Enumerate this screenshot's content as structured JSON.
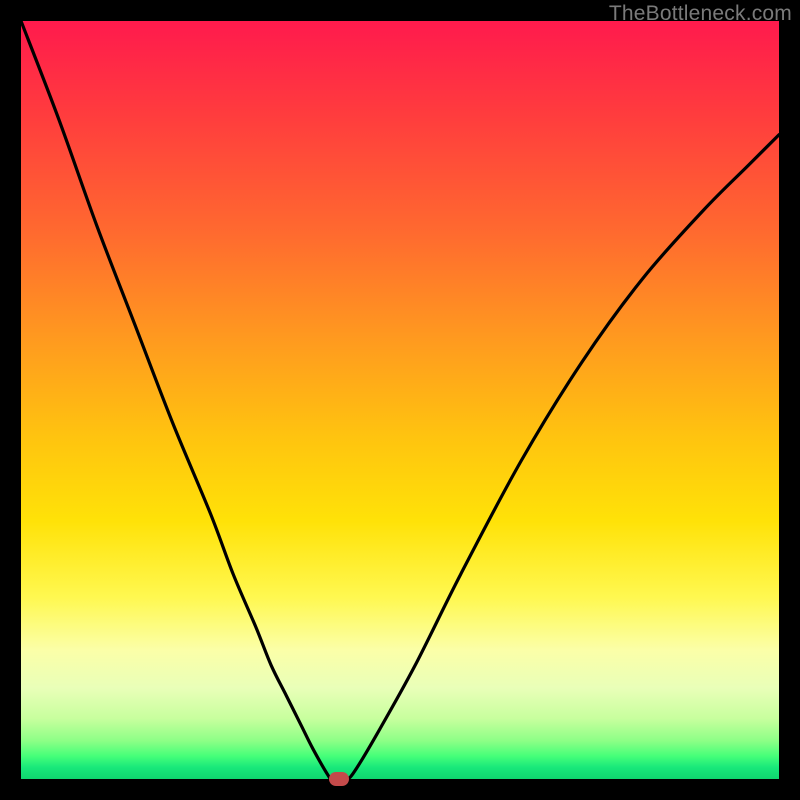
{
  "watermark": "TheBottleneck.com",
  "colors": {
    "frame": "#000000",
    "curve": "#000000",
    "marker": "#c44a4a"
  },
  "chart_data": {
    "type": "line",
    "title": "",
    "xlabel": "",
    "ylabel": "",
    "xlim": [
      0,
      100
    ],
    "ylim": [
      0,
      100
    ],
    "grid": false,
    "series": [
      {
        "name": "bottleneck-curve",
        "x": [
          0,
          5,
          10,
          15,
          20,
          25,
          28,
          31,
          33,
          35,
          37,
          38.5,
          40.5,
          41,
          42,
          43,
          44,
          47,
          52,
          58,
          66,
          74,
          82,
          90,
          96,
          100
        ],
        "values": [
          100,
          87,
          73,
          60,
          47,
          35,
          27,
          20,
          15,
          11,
          7,
          4,
          0.5,
          0,
          0,
          0,
          1,
          6,
          15,
          27,
          42,
          55,
          66,
          75,
          81,
          85
        ]
      }
    ],
    "marker": {
      "x": 42,
      "y": 0
    },
    "gradient_stops": [
      {
        "pct": 0,
        "color": "#ff1a4d"
      },
      {
        "pct": 50,
        "color": "#ffd000"
      },
      {
        "pct": 85,
        "color": "#fcffb0"
      },
      {
        "pct": 100,
        "color": "#10d870"
      }
    ]
  }
}
